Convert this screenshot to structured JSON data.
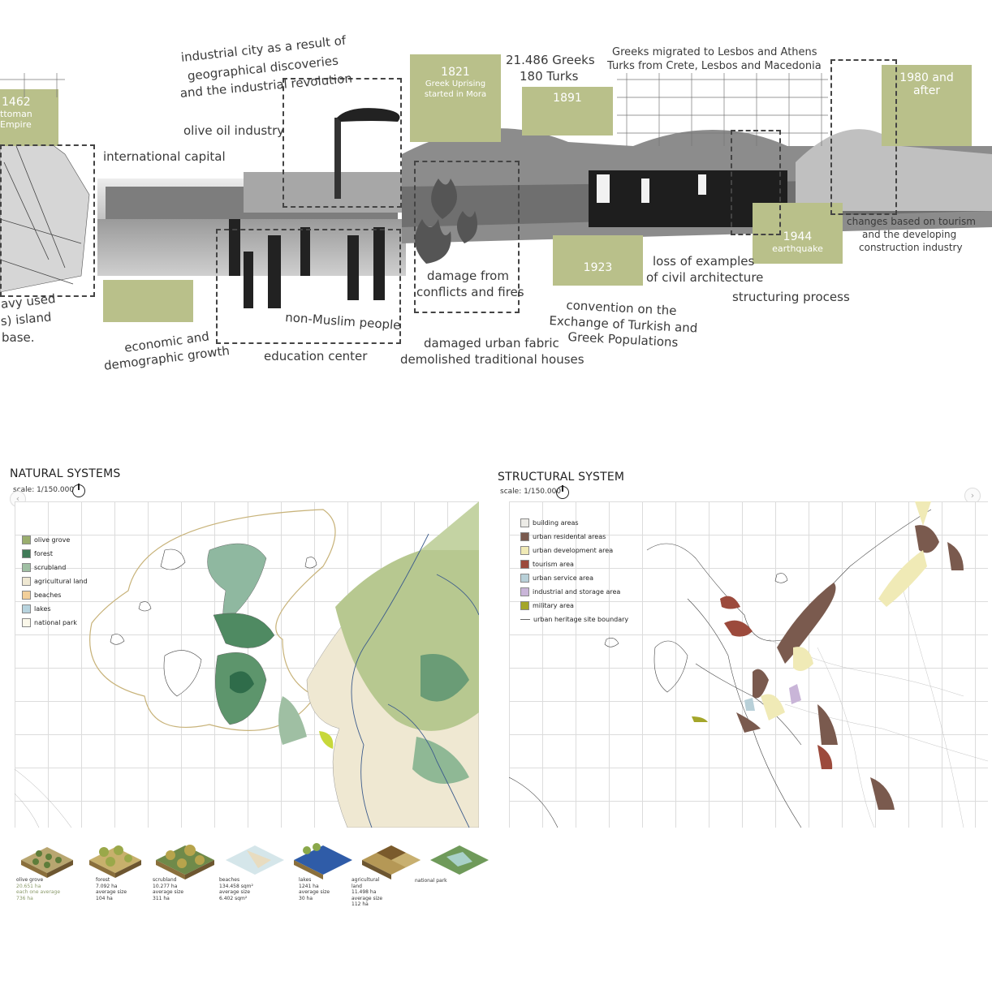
{
  "timeline": {
    "texts": {
      "industrial": "industrial city as a result of",
      "geo": "geographical discoveries",
      "revolution": "and the industrial revolution",
      "olive_oil": "olive oil industry",
      "intl_capital": "international capital",
      "navy1": "avy used",
      "navy2": "s) island",
      "navy3": "base.",
      "econ1": "economic and",
      "econ2": "demographic growth",
      "education": "education center",
      "nonmuslim": "non-Muslim people",
      "damage1": "damage from",
      "damage2": "conflicts and fires",
      "damaged1": "damaged urban fabric",
      "damaged2": "demolished traditional houses",
      "greeks_count": "21.486  Greeks",
      "turks_count": "180 Turks",
      "migrated1": "Greeks migrated to Lesbos and Athens",
      "migrated2": "Turks from Crete, Lesbos and Macedonia",
      "loss1": "loss of examples",
      "loss2": "of civil architecture",
      "convention1": "convention on the",
      "convention2": "Exchange of Turkish and",
      "convention3": "Greek Populations",
      "structuring": "structuring process",
      "tourism1": "changes based on tourism",
      "tourism2": "and the developing",
      "tourism3": "construction industry"
    },
    "boxes": {
      "b1462": {
        "year": "1462",
        "sub1": "ttoman",
        "sub2": "Empire"
      },
      "b1821": {
        "year": "1821",
        "sub1": "Greek Uprising",
        "sub2": "started in Mora"
      },
      "b1891": {
        "year": "1891"
      },
      "b1923": {
        "year": "1923"
      },
      "b1944": {
        "year": "1944",
        "sub1": "earthquake"
      },
      "b1980": {
        "year": "1980 and",
        "sub1": "after"
      }
    }
  },
  "natural": {
    "title": "NATURAL SYSTEMS",
    "scale": "scale: 1/150.000",
    "legend": [
      {
        "label": "olive grove",
        "color": "#9aae6e"
      },
      {
        "label": "forest",
        "color": "#3f7a57"
      },
      {
        "label": "scrubland",
        "color": "#9fbfa3"
      },
      {
        "label": "agricultural land",
        "color": "#efe8d2"
      },
      {
        "label": "beaches",
        "color": "#f2cf9a"
      },
      {
        "label": "lakes",
        "color": "#b7d3de"
      },
      {
        "label": "national park",
        "color": "#fbf8ea"
      }
    ],
    "iso": [
      {
        "l1": "olive grove",
        "l2": "20.651 ha",
        "l3": "each one average",
        "l4": "736 ha"
      },
      {
        "l1": "forest",
        "l2": "7.092 ha",
        "l3": "average size",
        "l4": "104 ha"
      },
      {
        "l1": "scrubland",
        "l2": "10.277 ha",
        "l3": "average size",
        "l4": "311 ha"
      },
      {
        "l1": "beaches",
        "l2": "134.458 sqm²",
        "l3": "average size",
        "l4": "6.402 sqm²"
      },
      {
        "l1": "lakes",
        "l2": "1241 ha",
        "l3": "average size",
        "l4": "30 ha"
      },
      {
        "l1": "agricultural",
        "l2": "land",
        "l3": "11.498 ha",
        "l4": "average size",
        "l5": "112 ha"
      },
      {
        "l1": "national park"
      }
    ]
  },
  "structural": {
    "title": "STRUCTURAL SYSTEM",
    "scale": "scale: 1/150.000",
    "legend": [
      {
        "label": "building areas",
        "color": "#ecebe6"
      },
      {
        "label": "urban residental areas",
        "color": "#7a5a4e"
      },
      {
        "label": "urban development area",
        "color": "#f0eab6"
      },
      {
        "label": "tourism area",
        "color": "#9c4a3c"
      },
      {
        "label": "urban service area",
        "color": "#b8d0d8"
      },
      {
        "label": "industrial and storage area",
        "color": "#c9b5d8"
      },
      {
        "label": "military area",
        "color": "#a4a62a"
      },
      {
        "label": "urban heritage site boundary",
        "line": true
      }
    ]
  },
  "icons": {
    "compass": "north-arrow-icon",
    "prev": "chevron-left-icon",
    "next": "chevron-right-icon"
  }
}
